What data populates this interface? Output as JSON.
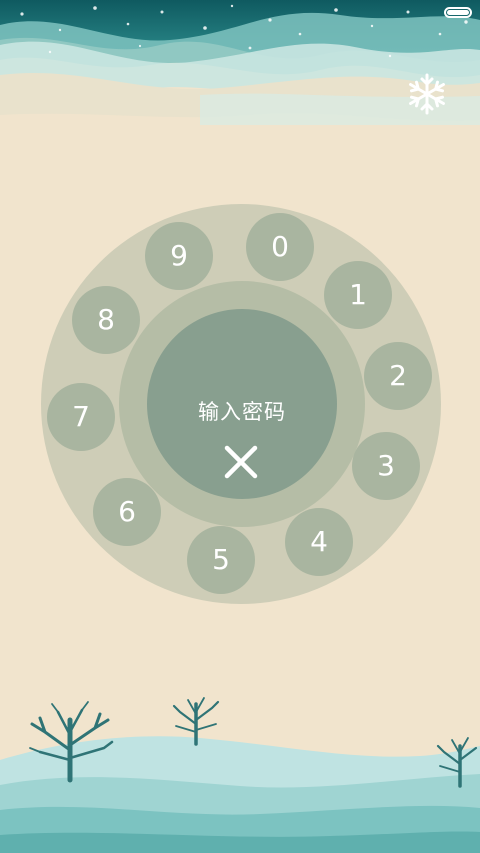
{
  "status_bar": {
    "battery_level": 1.0,
    "battery_icon": "battery-full-icon"
  },
  "decor": {
    "snowflake_icon": "snowflake-icon",
    "tree_icon": "bare-tree-icon"
  },
  "lock_screen": {
    "prompt": "输入密码",
    "delete_icon": "close-icon",
    "digits": [
      "0",
      "1",
      "2",
      "3",
      "4",
      "5",
      "6",
      "7",
      "8",
      "9"
    ]
  },
  "colors": {
    "background": "#f1e4cd",
    "dial_outer": "#cecdb7",
    "dial_ring": "#b5bda6",
    "dial_center": "#889f8f",
    "digit_button": "#a9b5a0",
    "sky_teal": "#1d6f72",
    "snow_hills": "#bfe3e2"
  }
}
